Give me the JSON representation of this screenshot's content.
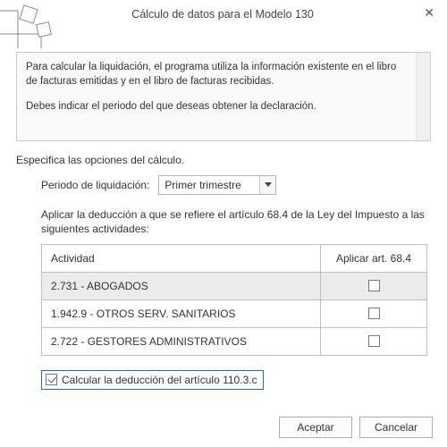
{
  "title": "Cálculo de datos para el Modelo 130",
  "info": {
    "p1": "Para calcular la liquidación, el programa utiliza la información existente en el libro de facturas emitidas y en el libro de facturas recibidas.",
    "p2": "Debes indicar el periodo del que deseas obtener la declaración."
  },
  "options_label": "Especifica las opciones del cálculo.",
  "period": {
    "label": "Periodo de liquidación:",
    "value": "Primer trimestre"
  },
  "deduction_intro": "Aplicar la deducción a que se refiere el artículo 68.4 de la Ley del Impuesto a las siguientes actividades:",
  "table": {
    "headers": {
      "activity": "Actividad",
      "apply": "Aplicar art. 68.4"
    },
    "rows": [
      {
        "activity": "2.731 - ABOGADOS",
        "apply": false
      },
      {
        "activity": "1.942.9 - OTROS SERV. SANITARIOS",
        "apply": false
      },
      {
        "activity": "2.722 - GESTORES ADMINISTRATIVOS",
        "apply": false
      }
    ]
  },
  "calc_1103c": {
    "label": "Calcular la deducción del artículo 110.3.c",
    "checked": true
  },
  "buttons": {
    "accept": "Aceptar",
    "cancel": "Cancelar"
  }
}
